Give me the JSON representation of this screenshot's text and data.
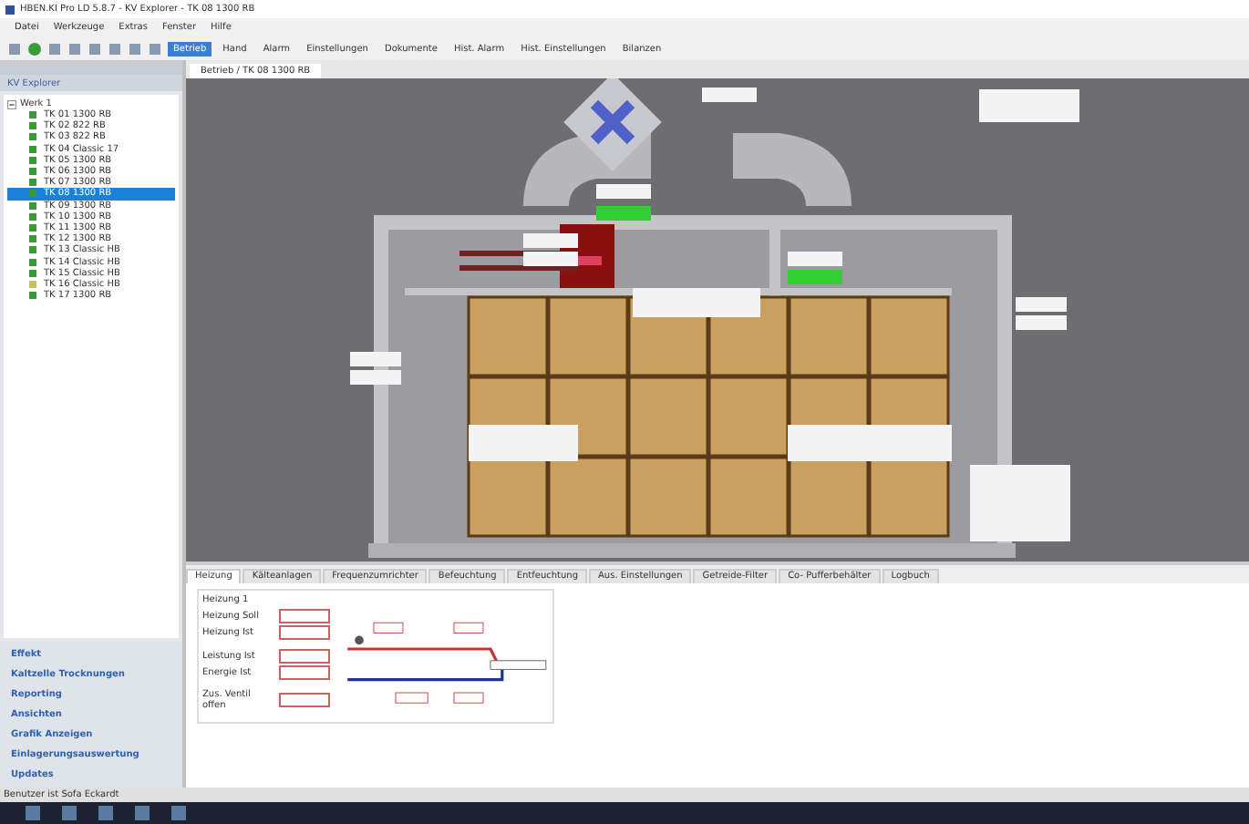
{
  "window": {
    "title": "HBEN.KI Pro LD 5.8.7 - KV Explorer - TK 08 1300 RB"
  },
  "menu": [
    "Datei",
    "Werkzeuge",
    "Extras",
    "Fenster",
    "Hilfe"
  ],
  "toolbar_tabs": [
    {
      "label": "Betrieb",
      "selected": true
    },
    {
      "label": "Hand",
      "selected": false
    },
    {
      "label": "Alarm",
      "selected": false
    },
    {
      "label": "Einstellungen",
      "selected": false
    },
    {
      "label": "Dokumente",
      "selected": false
    },
    {
      "label": "Hist. Alarm",
      "selected": false
    },
    {
      "label": "Hist. Einstellungen",
      "selected": false
    },
    {
      "label": "Bilanzen",
      "selected": false
    }
  ],
  "sidebar": {
    "title": "KV Explorer",
    "tree": [
      {
        "label": "Werk 1",
        "expanded": true,
        "children": [
          {
            "label": "TK 01 1300 RB",
            "color": "#3a9a3a",
            "selected": false
          },
          {
            "label": "TK 02 822 RB",
            "color": "#3a9a3a",
            "selected": false
          },
          {
            "label": "TK 03 822 RB",
            "color": "#3a9a3a",
            "selected": false
          },
          {
            "label": "TK 04 Classic 17",
            "color": "#3a9a3a",
            "selected": false
          },
          {
            "label": "TK 05 1300 RB",
            "color": "#3a9a3a",
            "selected": false
          },
          {
            "label": "TK 06 1300 RB",
            "color": "#3a9a3a",
            "selected": false
          },
          {
            "label": "TK 07 1300 RB",
            "color": "#3a9a3a",
            "selected": false
          },
          {
            "label": "TK 08 1300 RB",
            "color": "#3a9a3a",
            "selected": true
          },
          {
            "label": "TK 09 1300 RB",
            "color": "#3a9a3a",
            "selected": false
          },
          {
            "label": "TK 10 1300 RB",
            "color": "#3a9a3a",
            "selected": false
          },
          {
            "label": "TK 11 1300 RB",
            "color": "#3a9a3a",
            "selected": false
          },
          {
            "label": "TK 12 1300 RB",
            "color": "#3a9a3a",
            "selected": false
          },
          {
            "label": "TK 13 Classic HB",
            "color": "#3a9a3a",
            "selected": false
          },
          {
            "label": "TK 14 Classic HB",
            "color": "#3a9a3a",
            "selected": false
          },
          {
            "label": "TK 15 Classic HB",
            "color": "#3a9a3a",
            "selected": false
          },
          {
            "label": "TK 16 Classic HB",
            "color": "#c8c060",
            "selected": false
          },
          {
            "label": "TK 17 1300 RB",
            "color": "#3a9a3a",
            "selected": false
          }
        ]
      }
    ],
    "nav": [
      "Effekt",
      "Kaltzelle Trocknungen",
      "Reporting",
      "Ansichten",
      "Grafik Anzeigen",
      "Einlagerungsauswertung",
      "Updates"
    ]
  },
  "document_tab": "Betrieb / TK 08 1300 RB",
  "bottom_tabs": [
    {
      "label": "Heizung",
      "selected": true
    },
    {
      "label": "Kälteanlagen",
      "selected": false
    },
    {
      "label": "Frequenzumrichter",
      "selected": false
    },
    {
      "label": "Befeuchtung",
      "selected": false
    },
    {
      "label": "Entfeuchtung",
      "selected": false
    },
    {
      "label": "Aus. Einstellungen",
      "selected": false
    },
    {
      "label": "Getreide-Filter",
      "selected": false
    },
    {
      "label": "Co- Pufferbehälter",
      "selected": false
    },
    {
      "label": "Logbuch",
      "selected": false
    }
  ],
  "heating": {
    "title": "Heizung 1",
    "rows": [
      "Heizung Soll",
      "Heizung Ist",
      "Leistung Ist",
      "Energie Ist",
      "Zus. Ventil offen"
    ]
  },
  "status_bar": "Benutzer ist Sofa Eckardt"
}
